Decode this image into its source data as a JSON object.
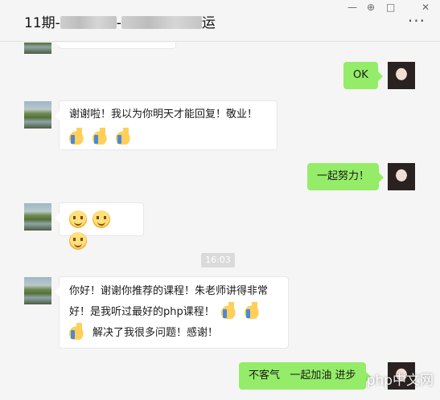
{
  "header": {
    "title_prefix": "11期-",
    "title_mid": "-",
    "title_suffix": "运",
    "window_minimize": "—",
    "window_pin": "⊕",
    "window_maximize": "□",
    "window_close": "✕",
    "more_label": "···"
  },
  "messages": {
    "m1": {
      "text": "OK"
    },
    "m2": {
      "line1": "谢谢啦！我以为你明天才能回复！敬业！"
    },
    "m3": {
      "text": "一起努力！"
    },
    "m4": {},
    "time_label": "16:03",
    "m5": {
      "line1": "你好！谢谢你推荐的课程！朱老师讲得非常",
      "line2": "好！是我听过最好的php课程！",
      "line3": "解决了我很多问题！感谢！"
    },
    "m6": {
      "text": "不客气   一起加油 进步"
    }
  },
  "watermark": "php中文网",
  "icons": {
    "thumb": "thumbs-up-emoji",
    "smile": "smile-emoji"
  }
}
